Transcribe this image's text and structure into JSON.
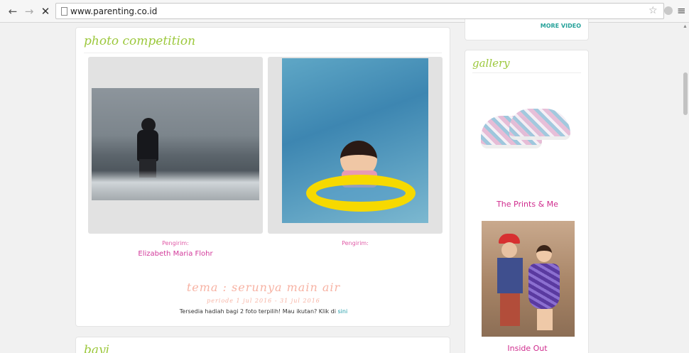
{
  "browser": {
    "url": "www.parenting.co.id"
  },
  "photo_competition": {
    "title": "photo competition",
    "entries": [
      {
        "sender_label": "Pengirim:",
        "sender_name": "Elizabeth Maria Flohr"
      },
      {
        "sender_label": "Pengirim:",
        "sender_name": ""
      }
    ],
    "theme": "tema : serunya main air",
    "period": "periode 1 jul 2016 - 31 jul 2016",
    "prize_text": "Tersedia hadiah bagi 2 foto terpilih! Mau ikutan? Klik di ",
    "prize_link": "sini"
  },
  "bayi": {
    "title": "bayi"
  },
  "sidebar": {
    "more_video": "MORE VIDEO",
    "gallery": {
      "title": "gallery",
      "items": [
        {
          "label": "The Prints & Me"
        },
        {
          "label": "Inside Out"
        }
      ]
    }
  }
}
